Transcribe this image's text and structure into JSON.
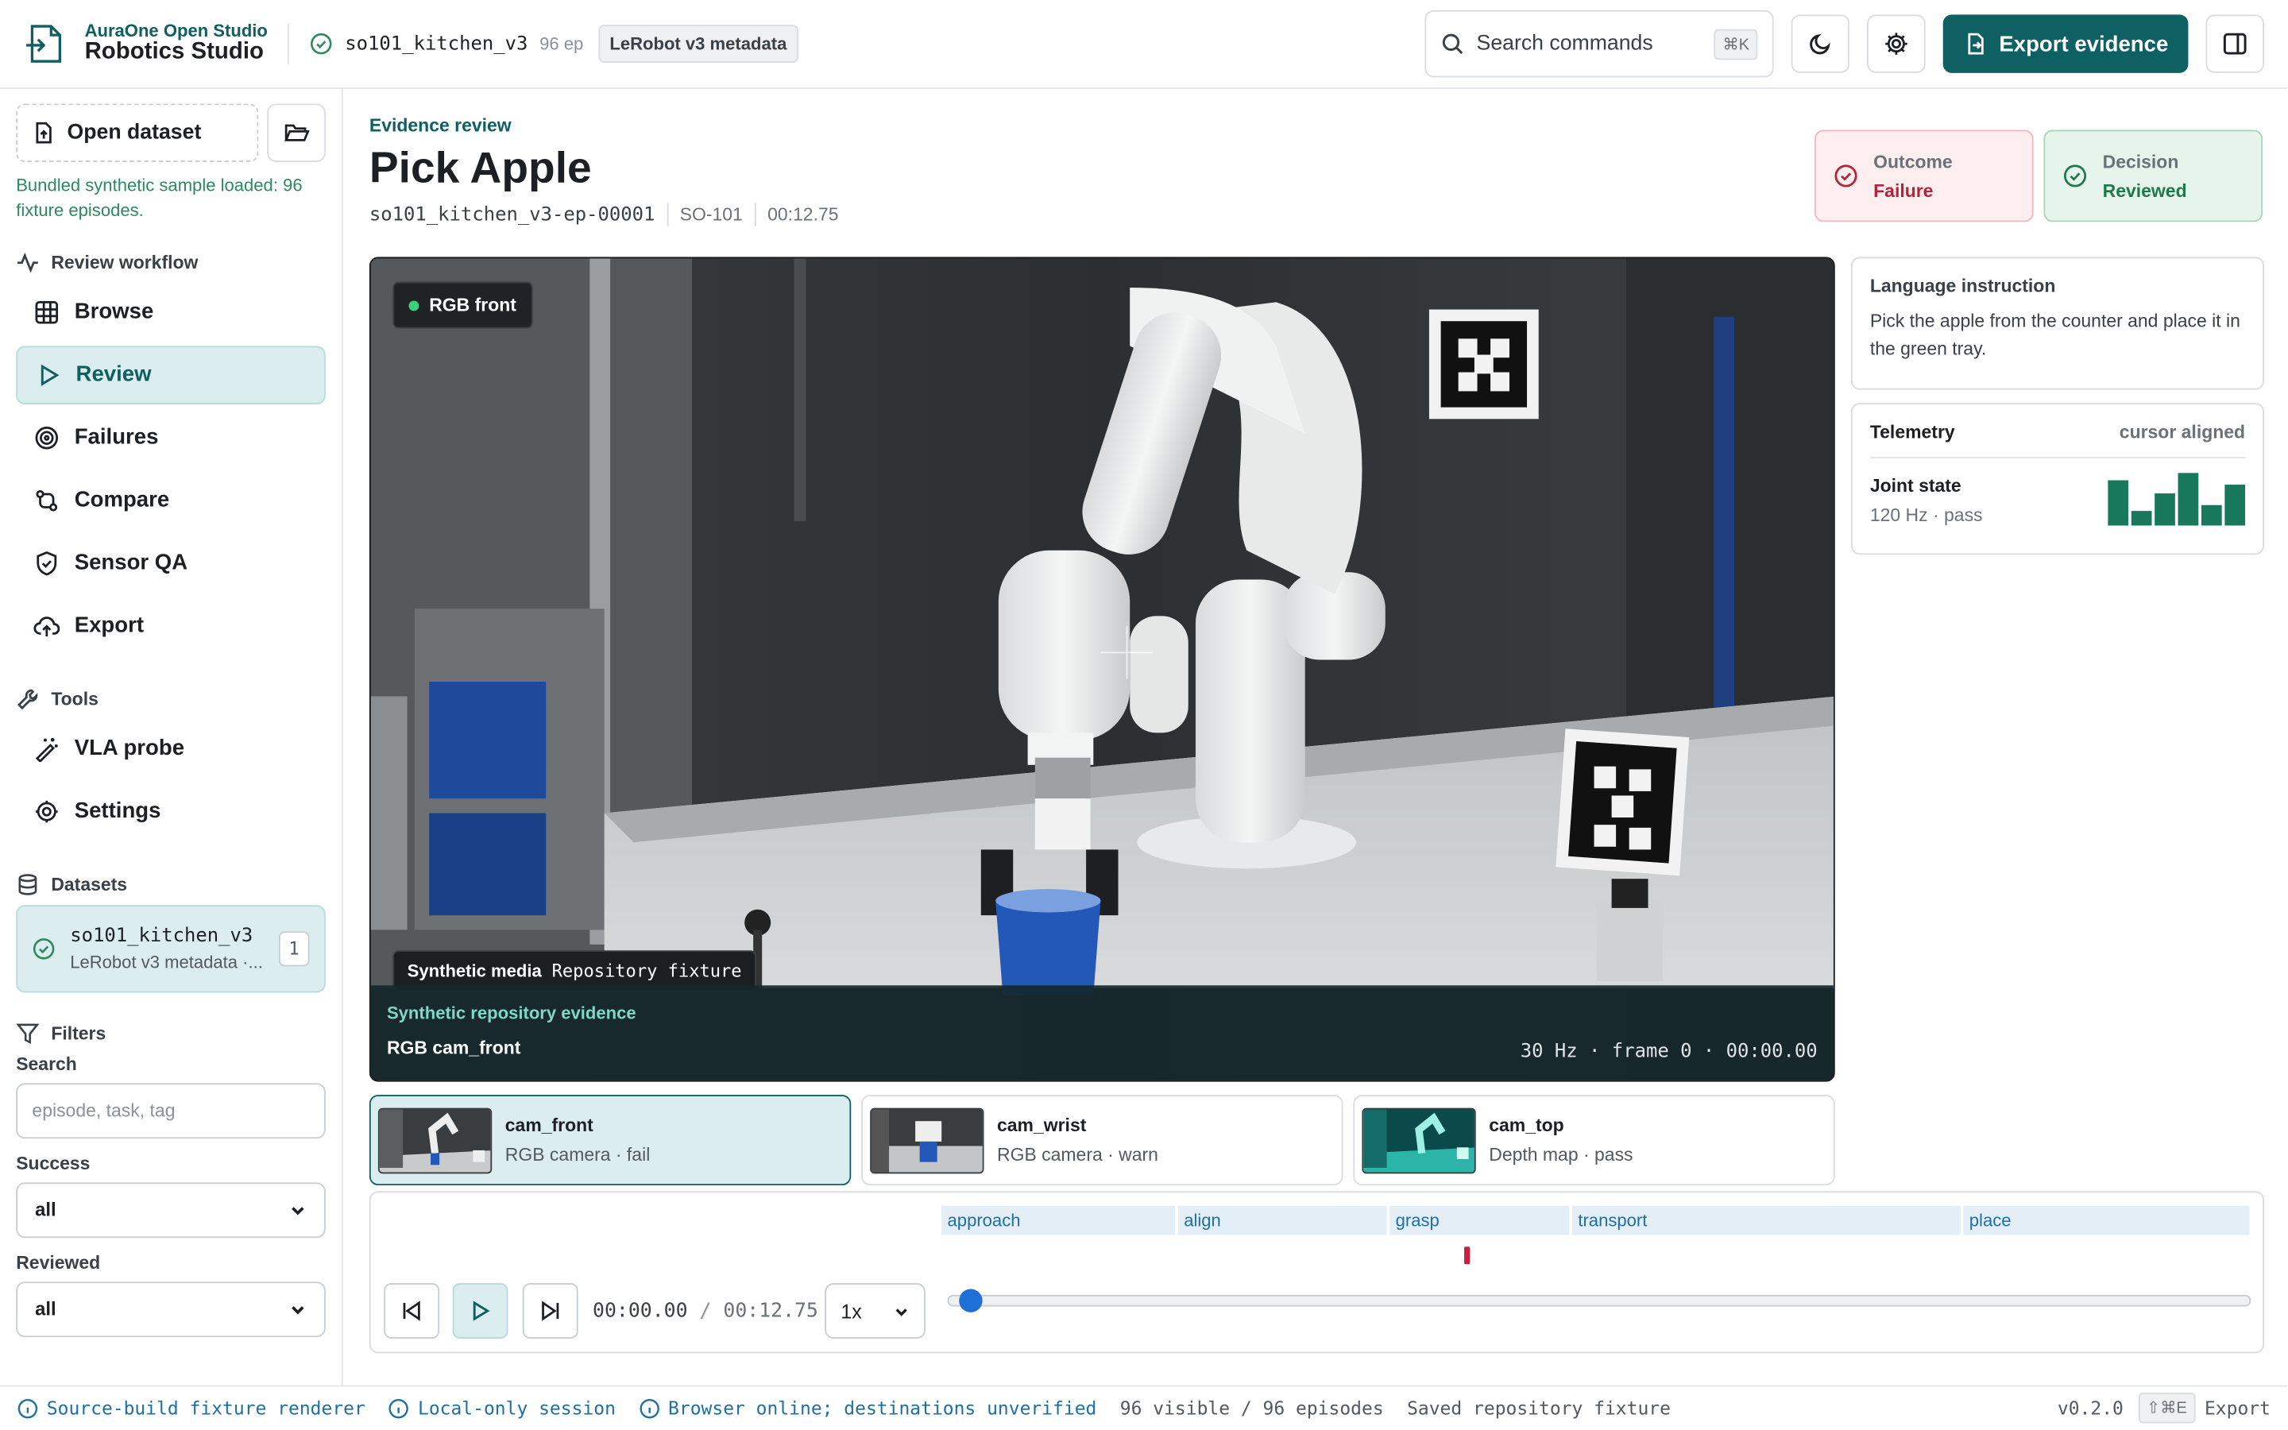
{
  "header": {
    "brand_top": "AuraOne Open Studio",
    "brand_bottom": "Robotics Studio",
    "dataset_name": "so101_kitchen_v3",
    "episode_count": "96 ep",
    "metadata_pill": "LeRobot v3 metadata",
    "search_placeholder": "Search commands",
    "search_shortcut": "⌘K",
    "export_label": "Export evidence"
  },
  "sidebar": {
    "open_dataset": "Open dataset",
    "loaded_msg": "Bundled synthetic sample loaded: 96 fixture episodes.",
    "workflow_title": "Review workflow",
    "workflow_items": [
      {
        "label": "Browse",
        "icon": "grid-icon"
      },
      {
        "label": "Review",
        "icon": "play-icon"
      },
      {
        "label": "Failures",
        "icon": "target-icon"
      },
      {
        "label": "Compare",
        "icon": "git-compare-icon"
      },
      {
        "label": "Sensor QA",
        "icon": "shield-check-icon"
      },
      {
        "label": "Export",
        "icon": "cloud-upload-icon"
      }
    ],
    "tools_title": "Tools",
    "tools_items": [
      {
        "label": "VLA probe",
        "icon": "wand-icon"
      },
      {
        "label": "Settings",
        "icon": "gear-icon"
      }
    ],
    "datasets_title": "Datasets",
    "dataset_card": {
      "name": "so101_kitchen_v3",
      "sub": "LeRobot v3 metadata ·...",
      "count": "1"
    },
    "filters_title": "Filters",
    "search_label": "Search",
    "search_placeholder": "episode, task, tag",
    "success_label": "Success",
    "success_value": "all",
    "reviewed_label": "Reviewed",
    "reviewed_value": "all"
  },
  "main": {
    "section": "Evidence review",
    "title": "Pick Apple",
    "episode_id": "so101_kitchen_v3-ep-00001",
    "robot": "SO-101",
    "duration": "00:12.75",
    "outcome_label": "Outcome",
    "outcome_value": "Failure",
    "decision_label": "Decision",
    "decision_value": "Reviewed",
    "video": {
      "camera_label": "RGB front",
      "synthetic_label": "Synthetic media",
      "synthetic_value": "Repository fixture",
      "evidence_label": "Synthetic repository evidence",
      "stream_name": "RGB cam_front",
      "stream_info": "30 Hz · frame 0 · 00:00.00"
    },
    "instruction_title": "Language instruction",
    "instruction_text": "Pick the apple from the counter and place it in the green tray.",
    "telemetry_title": "Telemetry",
    "telemetry_status": "cursor aligned",
    "joint_title": "Joint state",
    "joint_sub": "120 Hz · pass",
    "joint_levels": [
      0.85,
      0.2,
      0.55,
      1.0,
      0.3,
      0.75
    ],
    "cameras": [
      {
        "name": "cam_front",
        "desc": "RGB camera · fail"
      },
      {
        "name": "cam_wrist",
        "desc": "RGB camera · warn"
      },
      {
        "name": "cam_top",
        "desc": "Depth map · pass"
      }
    ],
    "phases": [
      "approach",
      "align",
      "grasp",
      "transport",
      "place"
    ],
    "time_current": "00:00.00",
    "time_sep": "/",
    "time_total": "00:12.75",
    "speed": "1x",
    "playhead_progress": 0.0
  },
  "statusbar": {
    "renderer": "Source-build fixture renderer",
    "session": "Local-only session",
    "network": "Browser online; destinations unverified",
    "visible": "96 visible / 96 episodes",
    "saved": "Saved repository fixture",
    "version": "v0.2.0",
    "export_kbd": "⇧⌘E",
    "export_label": "Export"
  },
  "colors": {
    "accent": "#0f6063",
    "failure": "#b4233a",
    "reviewed": "#1e7a4c"
  }
}
